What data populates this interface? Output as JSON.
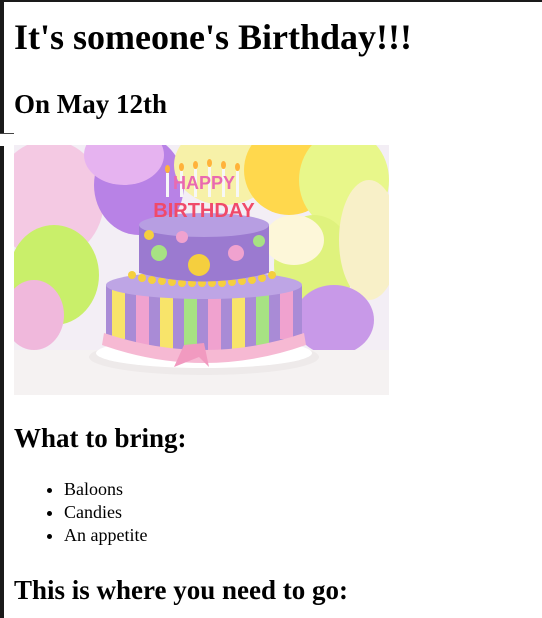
{
  "page": {
    "title": "It's someone's Birthday!!!",
    "date_heading": "On May 12th",
    "bring_heading": "What to bring:",
    "bring_items": [
      "Baloons",
      "Candies",
      "An appetite"
    ],
    "go_heading": "This is where you need to go:"
  },
  "image": {
    "cake_topper_line1": "HAPPY",
    "cake_topper_line2": "BIRTHDAY"
  }
}
